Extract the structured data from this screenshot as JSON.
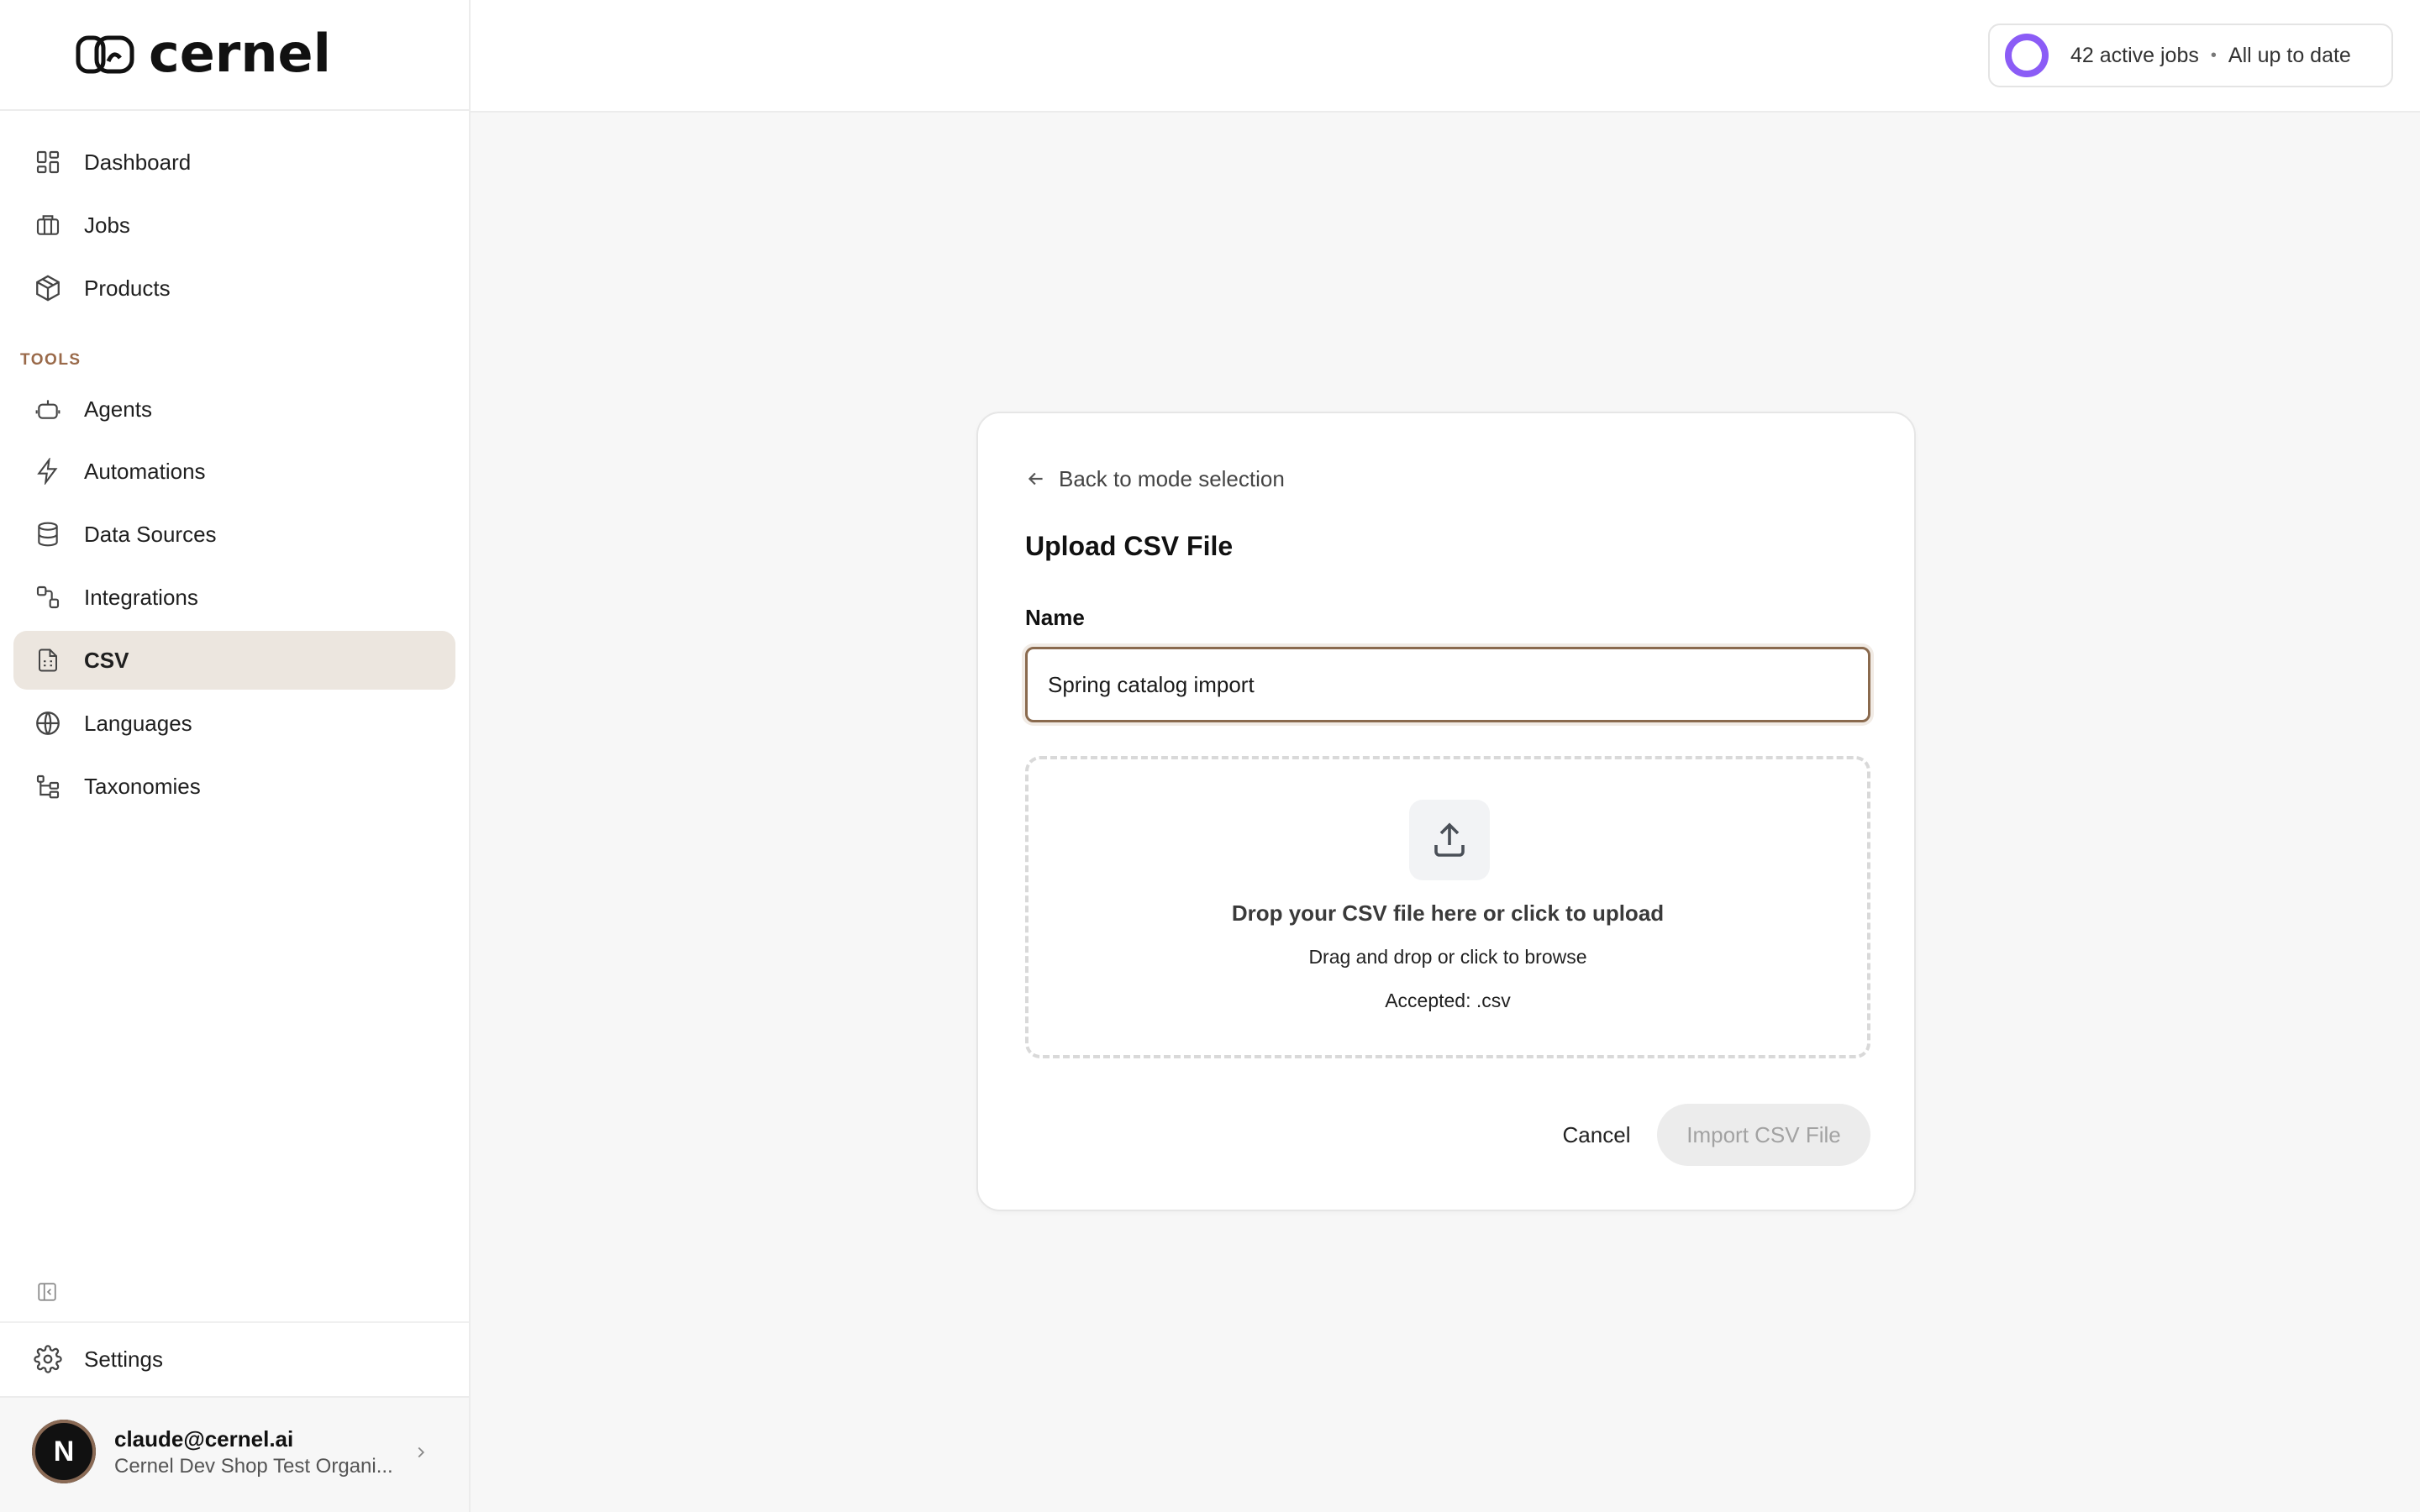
{
  "brand": {
    "logo_text": "cernel"
  },
  "sidebar": {
    "nav": [
      {
        "label": "Dashboard",
        "icon": "dashboard-icon"
      },
      {
        "label": "Jobs",
        "icon": "briefcase-icon"
      },
      {
        "label": "Products",
        "icon": "package-icon"
      }
    ],
    "tools_label": "TOOLS",
    "tools": [
      {
        "label": "Agents",
        "icon": "bot-icon"
      },
      {
        "label": "Automations",
        "icon": "lightning-icon"
      },
      {
        "label": "Data Sources",
        "icon": "database-icon"
      },
      {
        "label": "Integrations",
        "icon": "integrations-icon"
      },
      {
        "label": "CSV",
        "icon": "csv-file-icon",
        "active": true
      },
      {
        "label": "Languages",
        "icon": "globe-icon"
      },
      {
        "label": "Taxonomies",
        "icon": "hierarchy-icon"
      }
    ],
    "settings_label": "Settings",
    "user": {
      "avatar_initial": "N",
      "email": "claude@cernel.ai",
      "org": "Cernel Dev Shop Test Organi..."
    }
  },
  "topbar": {
    "status": {
      "jobs": "42 active jobs",
      "state": "All up to date",
      "separator": "•",
      "ring_color": "#8b5cf6"
    }
  },
  "upload": {
    "back_label": "Back to mode selection",
    "title": "Upload CSV File",
    "name_label": "Name",
    "name_value": "Spring catalog import",
    "dropzone": {
      "title": "Drop your CSV file here or click to upload",
      "subtitle": "Drag and drop or click to browse",
      "accepted": "Accepted: .csv"
    },
    "cancel_label": "Cancel",
    "import_label": "Import CSV File"
  },
  "colors": {
    "accent_brown": "#8a6a4e",
    "active_bg": "#ece6df",
    "section_label": "#9a6a4a"
  }
}
